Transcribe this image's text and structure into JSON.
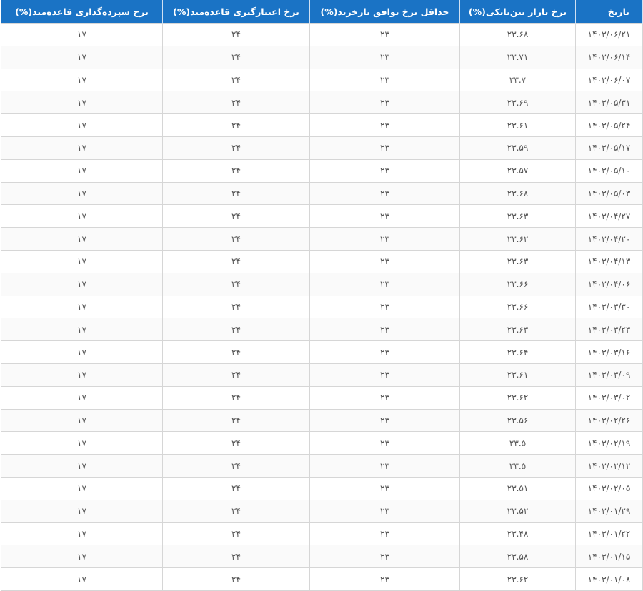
{
  "table": {
    "headers": [
      "تاریخ",
      "نرخ بازار بین‌بانکی(%)",
      "حداقل نرخ توافق بازخرید(%)",
      "نرخ اعتبارگیری قاعده‌مند(%)",
      "نرخ سپرده‌گذاری قاعده‌مند(%)"
    ],
    "rows": [
      [
        "۱۴۰۳/۰۶/۲۱",
        "۲۳.۶۸",
        "۲۳",
        "۲۴",
        "۱۷"
      ],
      [
        "۱۴۰۳/۰۶/۱۴",
        "۲۳.۷۱",
        "۲۳",
        "۲۴",
        "۱۷"
      ],
      [
        "۱۴۰۳/۰۶/۰۷",
        "۲۳.۷",
        "۲۳",
        "۲۴",
        "۱۷"
      ],
      [
        "۱۴۰۳/۰۵/۳۱",
        "۲۳.۶۹",
        "۲۳",
        "۲۴",
        "۱۷"
      ],
      [
        "۱۴۰۳/۰۵/۲۴",
        "۲۳.۶۱",
        "۲۳",
        "۲۴",
        "۱۷"
      ],
      [
        "۱۴۰۳/۰۵/۱۷",
        "۲۳.۵۹",
        "۲۳",
        "۲۴",
        "۱۷"
      ],
      [
        "۱۴۰۳/۰۵/۱۰",
        "۲۳.۵۷",
        "۲۳",
        "۲۴",
        "۱۷"
      ],
      [
        "۱۴۰۳/۰۵/۰۳",
        "۲۳.۶۸",
        "۲۳",
        "۲۴",
        "۱۷"
      ],
      [
        "۱۴۰۳/۰۴/۲۷",
        "۲۳.۶۳",
        "۲۳",
        "۲۴",
        "۱۷"
      ],
      [
        "۱۴۰۳/۰۴/۲۰",
        "۲۳.۶۲",
        "۲۳",
        "۲۴",
        "۱۷"
      ],
      [
        "۱۴۰۳/۰۴/۱۳",
        "۲۳.۶۳",
        "۲۳",
        "۲۴",
        "۱۷"
      ],
      [
        "۱۴۰۳/۰۴/۰۶",
        "۲۳.۶۶",
        "۲۳",
        "۲۴",
        "۱۷"
      ],
      [
        "۱۴۰۳/۰۳/۳۰",
        "۲۳.۶۶",
        "۲۳",
        "۲۴",
        "۱۷"
      ],
      [
        "۱۴۰۳/۰۳/۲۳",
        "۲۳.۶۳",
        "۲۳",
        "۲۴",
        "۱۷"
      ],
      [
        "۱۴۰۳/۰۳/۱۶",
        "۲۳.۶۴",
        "۲۳",
        "۲۴",
        "۱۷"
      ],
      [
        "۱۴۰۳/۰۳/۰۹",
        "۲۳.۶۱",
        "۲۳",
        "۲۴",
        "۱۷"
      ],
      [
        "۱۴۰۳/۰۳/۰۲",
        "۲۳.۶۲",
        "۲۳",
        "۲۴",
        "۱۷"
      ],
      [
        "۱۴۰۳/۰۲/۲۶",
        "۲۳.۵۶",
        "۲۳",
        "۲۴",
        "۱۷"
      ],
      [
        "۱۴۰۳/۰۲/۱۹",
        "۲۳.۵",
        "۲۳",
        "۲۴",
        "۱۷"
      ],
      [
        "۱۴۰۳/۰۲/۱۲",
        "۲۳.۵",
        "۲۳",
        "۲۴",
        "۱۷"
      ],
      [
        "۱۴۰۳/۰۲/۰۵",
        "۲۳.۵۱",
        "۲۳",
        "۲۴",
        "۱۷"
      ],
      [
        "۱۴۰۳/۰۱/۲۹",
        "۲۳.۵۲",
        "۲۳",
        "۲۴",
        "۱۷"
      ],
      [
        "۱۴۰۳/۰۱/۲۲",
        "۲۳.۴۸",
        "۲۳",
        "۲۴",
        "۱۷"
      ],
      [
        "۱۴۰۳/۰۱/۱۵",
        "۲۳.۵۸",
        "۲۳",
        "۲۴",
        "۱۷"
      ],
      [
        "۱۴۰۳/۰۱/۰۸",
        "۲۳.۶۲",
        "۲۳",
        "۲۴",
        "۱۷"
      ]
    ]
  },
  "colors": {
    "header_bg": "#1a73c5",
    "header_text": "#ffffff",
    "cell_text": "#555555",
    "border": "#d6d6d6"
  }
}
